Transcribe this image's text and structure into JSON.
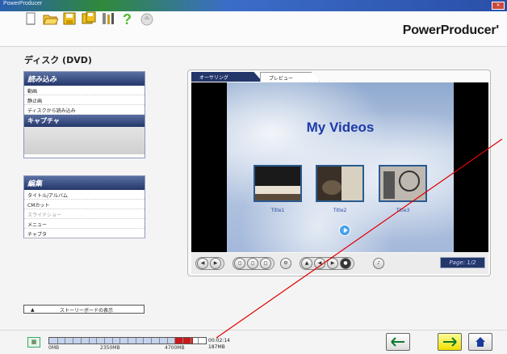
{
  "window": {
    "title": "PowerProducer",
    "close_label": "×"
  },
  "brand": {
    "name": "PowerProducer",
    "mark": "'"
  },
  "toolbar": {
    "icons": [
      "new-icon",
      "open-folder-icon",
      "save-icon",
      "save-as-icon",
      "tools-icon",
      "help-icon",
      "update-icon"
    ]
  },
  "disc": {
    "title": "ディスク (DVD)"
  },
  "import_panel": {
    "header": "読み込み",
    "items": [
      "動画",
      "静止画",
      "ディスクから読み込み"
    ],
    "capture_label": "キャプチャ"
  },
  "edit_panel": {
    "header": "編集",
    "items": [
      {
        "label": "タイトル/アルバム",
        "enabled": true
      },
      {
        "label": "CMカット",
        "enabled": true
      },
      {
        "label": "スライドショー",
        "enabled": false
      },
      {
        "label": "メニュー",
        "enabled": true
      },
      {
        "label": "チャプタ",
        "enabled": true
      }
    ]
  },
  "storyboard_toggle": {
    "label": "ストーリーボードの表示"
  },
  "preview": {
    "tabs": [
      "オーサリング",
      "プレビュー"
    ],
    "active_tab": "オーサリング",
    "menu_title": "My Videos",
    "thumbnails": [
      {
        "label": "Title1"
      },
      {
        "label": "Title2"
      },
      {
        "label": "Title3"
      }
    ],
    "page_indicator": "Page: 1/2"
  },
  "capacity": {
    "labels": [
      "0MB",
      "2350MB",
      "4700MB"
    ],
    "used_fraction": 0.8,
    "over_fraction": 0.12,
    "duration": "00:02:14",
    "size": "187MB"
  },
  "nav": {
    "back_icon": "arrow-left-icon",
    "next_icon": "arrow-right-icon",
    "home_icon": "home-icon"
  },
  "colors": {
    "panel_header": "#24376b",
    "menu_title": "#1d3aa8",
    "capacity_over": "#cc1818",
    "next_button": "#f0de00",
    "annotation_line": "#e00000"
  }
}
